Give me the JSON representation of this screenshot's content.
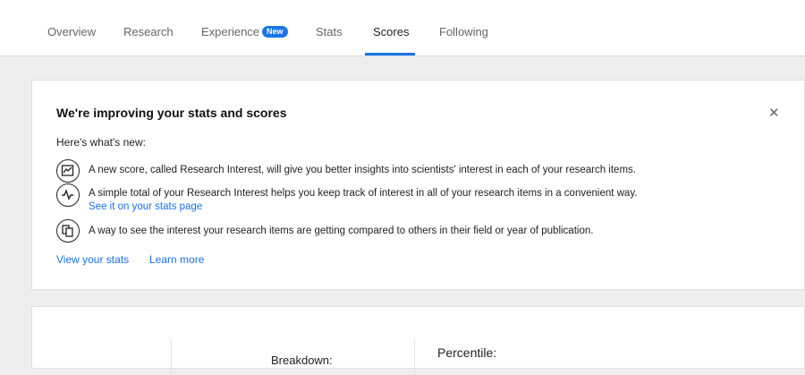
{
  "nav": {
    "tabs": [
      {
        "label": "Overview"
      },
      {
        "label": "Research"
      },
      {
        "label": "Experience",
        "badge": "New"
      },
      {
        "label": "Stats"
      },
      {
        "label": "Scores",
        "active": true
      },
      {
        "label": "Following"
      }
    ],
    "accent_color": "#1a73e8"
  },
  "banner": {
    "title": "We're improving your stats and scores",
    "close_icon": "close-icon",
    "subtitle": "Here's what's new:",
    "features": [
      {
        "icon": "score-icon",
        "text": "A new score, called Research Interest, will give you better insights into scientists' interest in each of your research items."
      },
      {
        "icon": "pulse-icon",
        "text": "A simple total of your Research Interest helps you keep track of interest in all of your research items in a convenient way.",
        "link": "See it on your stats page"
      },
      {
        "icon": "compare-icon",
        "text": "A way to see the interest your research items are getting compared to others in their field or year of publication."
      }
    ],
    "actions": {
      "view_stats": "View your stats",
      "learn_more": "Learn more"
    }
  },
  "scores_panel": {
    "breakdown_label": "Breakdown:",
    "percentile_label": "Percentile:"
  }
}
